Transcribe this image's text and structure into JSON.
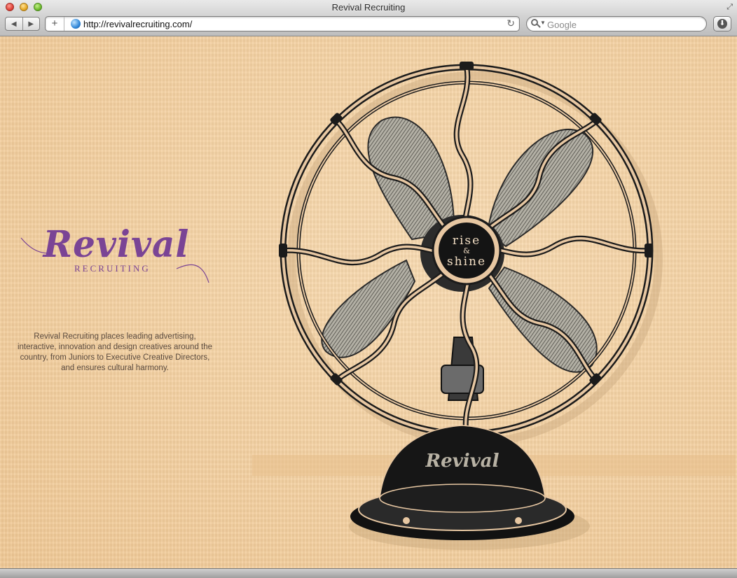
{
  "browser": {
    "window_title": "Revival Recruiting",
    "url": "http://revivalrecruiting.com/",
    "search_placeholder": "Google",
    "nav": {
      "back_glyph": "◀",
      "forward_glyph": "▶"
    },
    "add_tab_glyph": "+",
    "reload_glyph": "↻",
    "downloads_glyph": "⬇",
    "resize_glyph": "⤢"
  },
  "page": {
    "logo": {
      "word": "Revival",
      "subtitle": "RECRUITING"
    },
    "tagline_lines": [
      "Revival Recruiting places leading advertising,",
      "interactive, innovation and design creatives around the",
      "country, from Juniors to Executive Creative Directors,",
      "and ensures cultural harmony."
    ],
    "fan": {
      "hub_text": {
        "line1": "rise",
        "line2": "&",
        "line3": "shine"
      },
      "base_brand": "Revival"
    }
  },
  "colors": {
    "background": "#f3cf9f",
    "brand_purple": "#7a4495",
    "tagline_text": "#5a4a3e",
    "fan_dark": "#1a1a1a",
    "blade_gray": "#a6a49a"
  }
}
